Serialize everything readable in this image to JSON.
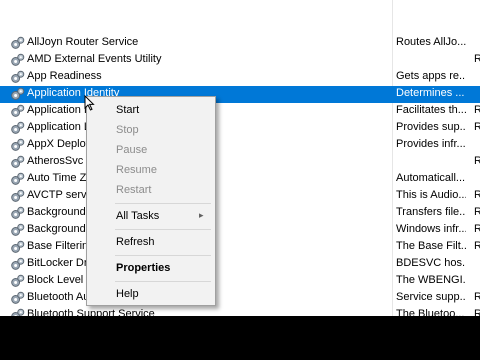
{
  "services": [
    {
      "name": "AllJoyn Router Service",
      "desc": "Routes AllJo...",
      "stat": ""
    },
    {
      "name": "AMD External Events Utility",
      "desc": "",
      "stat": "R"
    },
    {
      "name": "App Readiness",
      "desc": "Gets apps re...",
      "stat": ""
    },
    {
      "name": "Application Identity",
      "desc": "Determines ...",
      "stat": ""
    },
    {
      "name": "Application I",
      "desc": "Facilitates th...",
      "stat": "R"
    },
    {
      "name": "Application L",
      "desc": "Provides sup...",
      "stat": "R"
    },
    {
      "name": "AppX Deploy",
      "desc": "Provides infr...",
      "stat": ""
    },
    {
      "name": "AtherosSvc",
      "desc": "",
      "stat": "R"
    },
    {
      "name": "Auto Time Z",
      "desc": "Automaticall...",
      "stat": ""
    },
    {
      "name": "AVCTP servic",
      "desc": "This is Audio...",
      "stat": "R"
    },
    {
      "name": "Background",
      "desc": "Transfers file...",
      "stat": "R"
    },
    {
      "name": "Background",
      "desc": "Windows infr...",
      "stat": "R"
    },
    {
      "name": "Base Filtering",
      "desc": "The Base Filt...",
      "stat": "R"
    },
    {
      "name": "BitLocker Dri",
      "desc": "BDESVC hos...",
      "stat": ""
    },
    {
      "name": "Block Level E",
      "desc": "The WBENGI...",
      "stat": ""
    },
    {
      "name": "Bluetooth Au",
      "desc": "Service supp...",
      "stat": "R"
    },
    {
      "name": "Bluetooth Support Service",
      "desc": "The Bluetoo...",
      "stat": "R"
    }
  ],
  "selected_index": 3,
  "context_menu": {
    "start": "Start",
    "stop": "Stop",
    "pause": "Pause",
    "resume": "Resume",
    "restart": "Restart",
    "all_tasks": "All Tasks",
    "refresh": "Refresh",
    "properties": "Properties",
    "help": "Help"
  },
  "colors": {
    "selection": "#0078d7",
    "menu_bg": "#f2f2f2",
    "disabled_text": "#8c8c8c"
  },
  "icon": "gear-icon"
}
